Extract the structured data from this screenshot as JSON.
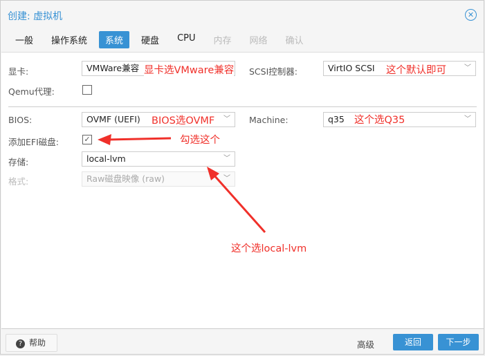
{
  "window": {
    "title": "创建: 虚拟机"
  },
  "tabs": [
    {
      "label": "一般"
    },
    {
      "label": "操作系统"
    },
    {
      "label": "系统",
      "active": true
    },
    {
      "label": "硬盘"
    },
    {
      "label": "CPU"
    },
    {
      "label": "内存",
      "disabled": true
    },
    {
      "label": "网络",
      "disabled": true
    },
    {
      "label": "确认",
      "disabled": true
    }
  ],
  "form": {
    "graphics": {
      "label": "显卡:",
      "value": "VMWare兼容"
    },
    "scsi": {
      "label": "SCSI控制器:",
      "value": "VirtIO SCSI"
    },
    "qemu": {
      "label": "Qemu代理:",
      "checked": false
    },
    "bios": {
      "label": "BIOS:",
      "value": "OVMF (UEFI)"
    },
    "machine": {
      "label": "Machine:",
      "value": "q35"
    },
    "efi": {
      "label": "添加EFI磁盘:",
      "checked": true
    },
    "storage": {
      "label": "存储:",
      "value": "local-lvm"
    },
    "format": {
      "label": "格式:",
      "value": "Raw磁盘映像 (raw)",
      "disabled": true
    }
  },
  "annotations": {
    "graphics": "显卡选VMware兼容",
    "scsi": "这个默认即可",
    "bios": "BIOS选OVMF",
    "machine": "这个选Q35",
    "efi": "勾选这个",
    "storage": "这个选local-lvm"
  },
  "footer": {
    "help": "帮助",
    "advanced": "高级",
    "back": "返回",
    "next": "下一步"
  },
  "colors": {
    "accent": "#3892d4",
    "annotation": "#f0302a"
  }
}
